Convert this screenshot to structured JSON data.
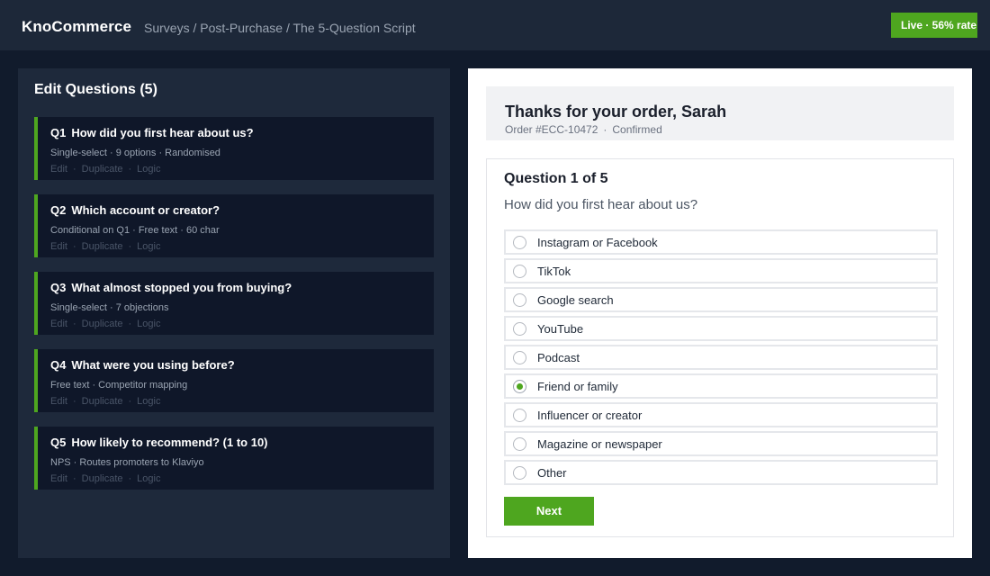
{
  "header": {
    "brand": "KnoCommerce",
    "breadcrumb": "Surveys / Post-Purchase / The 5-Question Script",
    "live_badge": "Live · 56% rate"
  },
  "editor": {
    "title": "Edit Questions (5)",
    "actions": {
      "edit": "Edit",
      "duplicate": "Duplicate",
      "logic": "Logic",
      "separator": "·"
    },
    "questions": [
      {
        "num": "Q1",
        "title": "How did you first hear about us?",
        "meta": "Single-select · 9 options · Randomised"
      },
      {
        "num": "Q2",
        "title": "Which account or creator?",
        "meta": "Conditional on Q1 · Free text · 60 char"
      },
      {
        "num": "Q3",
        "title": "What almost stopped you from buying?",
        "meta": "Single-select · 7 objections"
      },
      {
        "num": "Q4",
        "title": "What were you using before?",
        "meta": "Free text · Competitor mapping"
      },
      {
        "num": "Q5",
        "title": "How likely to recommend? (1 to 10)",
        "meta": "NPS · Routes promoters to Klaviyo"
      }
    ]
  },
  "preview": {
    "greeting": "Thanks for your order, Sarah",
    "order_number": "Order #ECC-10472",
    "order_separator": "·",
    "order_status": "Confirmed",
    "question_counter": "Question 1 of 5",
    "question_text": "How did you first hear about us?",
    "options": [
      {
        "label": "Instagram or Facebook",
        "selected": false
      },
      {
        "label": "TikTok",
        "selected": false
      },
      {
        "label": "Google search",
        "selected": false
      },
      {
        "label": "YouTube",
        "selected": false
      },
      {
        "label": "Podcast",
        "selected": false
      },
      {
        "label": "Friend or family",
        "selected": true
      },
      {
        "label": "Influencer or creator",
        "selected": false
      },
      {
        "label": "Magazine or newspaper",
        "selected": false
      },
      {
        "label": "Other",
        "selected": false
      }
    ],
    "next_label": "Next"
  },
  "colors": {
    "accent": "#4ea61f",
    "page_bg": "#111b2c",
    "topbar_bg": "#1d2839",
    "panel_bg": "#1e293b",
    "card_bg": "#0f1729"
  }
}
